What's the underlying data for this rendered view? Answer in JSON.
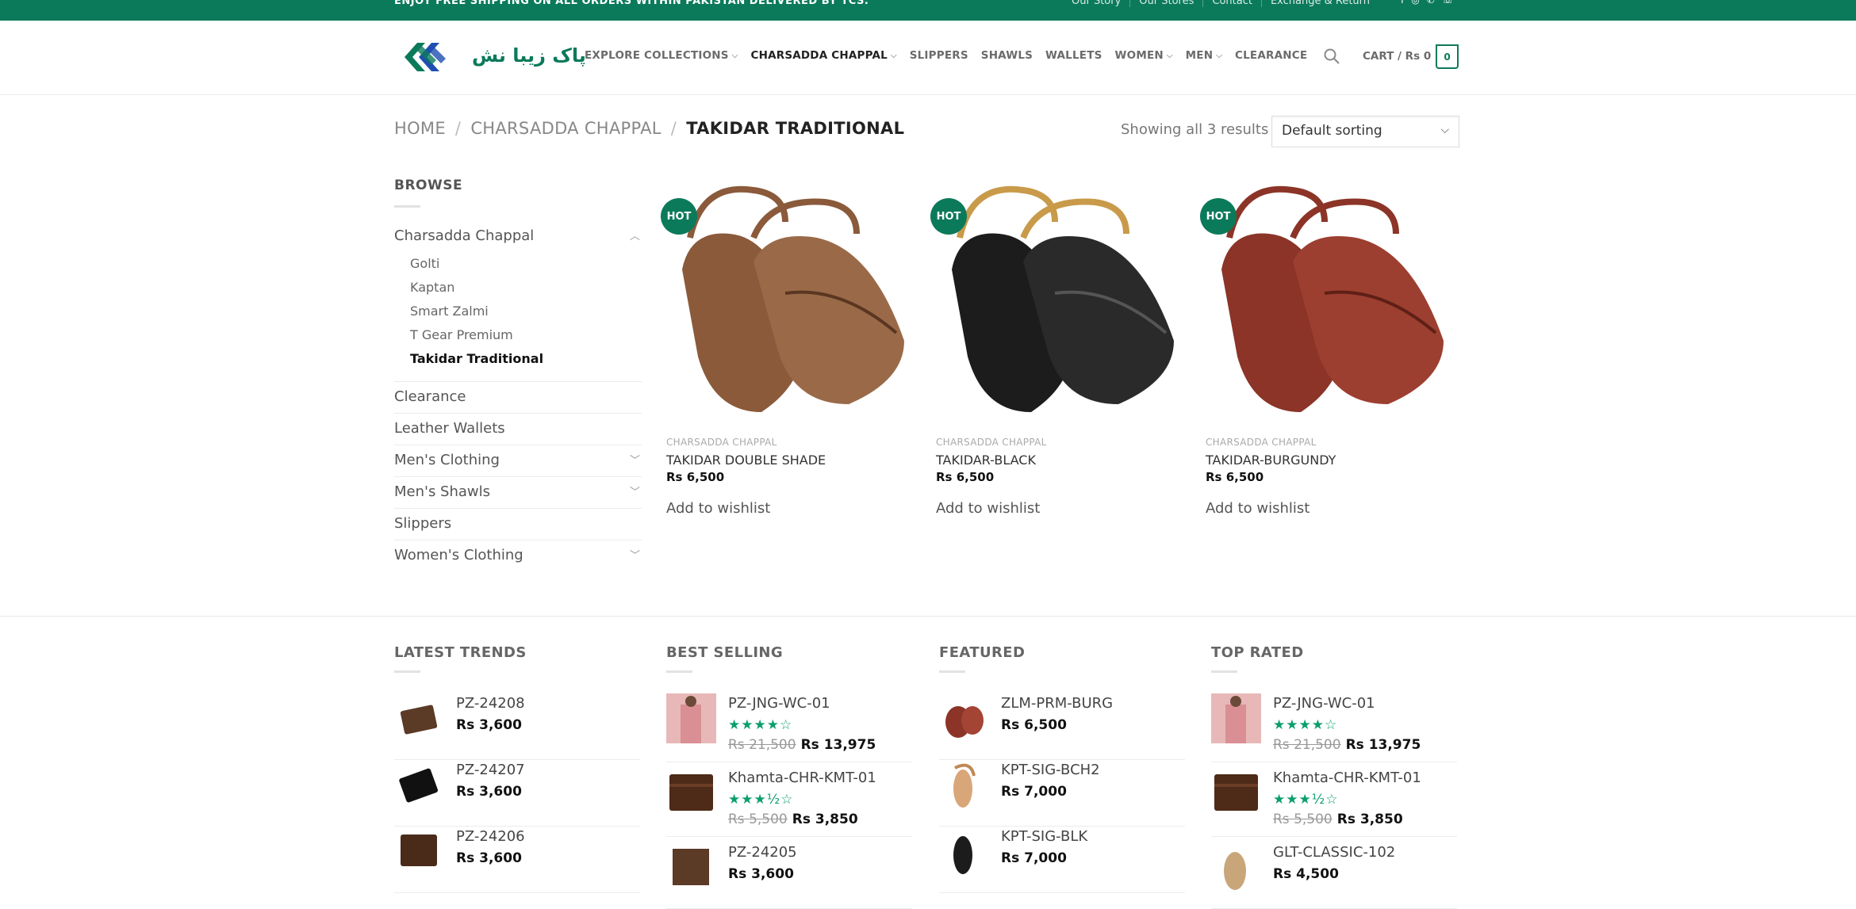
{
  "topbar": {
    "promo": "ENJOY FREE SHIPPING ON ALL ORDERS WITHIN PAKISTAN DELIVERED BY TCS.",
    "links": [
      "Our Story",
      "Our Stores",
      "Contact",
      "Exchange & Return"
    ],
    "social_icons": [
      "facebook-icon",
      "instagram-icon",
      "whatsapp-icon",
      "phone-icon"
    ]
  },
  "header": {
    "logo_text": "پاک زیبا نش",
    "nav": [
      {
        "label": "EXPLORE COLLECTIONS",
        "dropdown": true
      },
      {
        "label": "CHARSADDA CHAPPAL",
        "dropdown": true,
        "active": true
      },
      {
        "label": "SLIPPERS",
        "dropdown": false
      },
      {
        "label": "SHAWLS",
        "dropdown": false
      },
      {
        "label": "WALLETS",
        "dropdown": false
      },
      {
        "label": "WOMEN",
        "dropdown": true
      },
      {
        "label": "MEN",
        "dropdown": true
      },
      {
        "label": "CLEARANCE",
        "dropdown": false
      }
    ],
    "cart_label": "CART / Rs 0",
    "cart_count": "0"
  },
  "breadcrumb": {
    "items": [
      "HOME",
      "CHARSADDA CHAPPAL"
    ],
    "current": "TAKIDAR TRADITIONAL",
    "separator": "/"
  },
  "results": {
    "showing": "Showing all 3 results",
    "sort_selected": "Default sorting"
  },
  "sidebar": {
    "title": "BROWSE",
    "parent": "Charsadda Chappal",
    "subcategories": [
      "Golti",
      "Kaptan",
      "Smart Zalmi",
      "T Gear Premium",
      "Takidar Traditional"
    ],
    "categories": [
      "Clearance",
      "Leather Wallets",
      "Men's Clothing",
      "Men's Shawls",
      "Slippers",
      "Women's Clothing"
    ]
  },
  "products": [
    {
      "badge": "HOT",
      "category": "CHARSADDA CHAPPAL",
      "name": "TAKIDAR DOUBLE SHADE",
      "price": "Rs 6,500",
      "wishlist": "Add to wishlist",
      "color": "#8a5a3b"
    },
    {
      "badge": "HOT",
      "category": "CHARSADDA CHAPPAL",
      "name": "TAKIDAR-BLACK",
      "price": "Rs 6,500",
      "wishlist": "Add to wishlist",
      "color": "#1c1c1c"
    },
    {
      "badge": "HOT",
      "category": "CHARSADDA CHAPPAL",
      "name": "TAKIDAR-BURGUNDY",
      "price": "Rs 6,500",
      "wishlist": "Add to wishlist",
      "color": "#8b3427"
    }
  ],
  "footer": {
    "latest": {
      "title": "LATEST TRENDS",
      "items": [
        {
          "name": "PZ-24208",
          "price": "Rs 3,600"
        },
        {
          "name": "PZ-24207",
          "price": "Rs 3,600"
        },
        {
          "name": "PZ-24206",
          "price": "Rs 3,600"
        }
      ]
    },
    "best": {
      "title": "BEST SELLING",
      "items": [
        {
          "name": "PZ-JNG-WC-01",
          "old": "Rs 21,500",
          "price": "Rs 13,975",
          "rating": 4
        },
        {
          "name": "Khamta-CHR-KMT-01",
          "old": "Rs 5,500",
          "price": "Rs 3,850",
          "rating": 3.5
        },
        {
          "name": "PZ-24205",
          "price": "Rs 3,600"
        }
      ]
    },
    "featured": {
      "title": "FEATURED",
      "items": [
        {
          "name": "ZLM-PRM-BURG",
          "price": "Rs 6,500"
        },
        {
          "name": "KPT-SIG-BCH2",
          "price": "Rs 7,000"
        },
        {
          "name": "KPT-SIG-BLK",
          "price": "Rs 7,000"
        }
      ]
    },
    "top": {
      "title": "TOP RATED",
      "items": [
        {
          "name": "PZ-JNG-WC-01",
          "old": "Rs 21,500",
          "price": "Rs 13,975",
          "rating": 4
        },
        {
          "name": "Khamta-CHR-KMT-01",
          "old": "Rs 5,500",
          "price": "Rs 3,850",
          "rating": 3.5
        },
        {
          "name": "GLT-CLASSIC-102",
          "price": "Rs 4,500"
        }
      ]
    }
  },
  "colors": {
    "brand": "#0b7a5a",
    "star": "#0b9e6d"
  }
}
